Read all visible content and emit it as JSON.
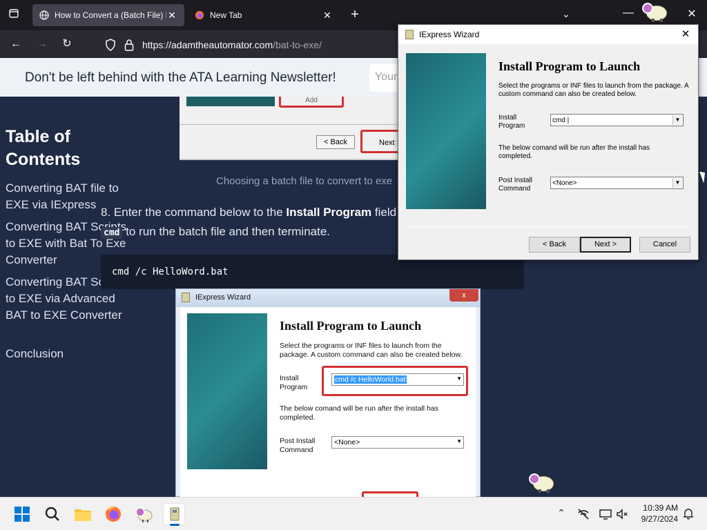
{
  "browser": {
    "tabs": [
      {
        "title": "How to Convert a (Batch File) BAT to EXE",
        "active": true
      },
      {
        "title": "New Tab",
        "active": false
      }
    ],
    "url_host": "https://adamtheautomator.com",
    "url_path": "/bat-to-exe/"
  },
  "page": {
    "newsletter_text": "Don't be left behind with the ATA Learning Newsletter!",
    "email_placeholder": "Your",
    "toc_title": "Table of Contents",
    "toc_items": [
      "Converting BAT file to EXE via IExpress",
      "Converting BAT Scripts to EXE with Bat To Exe Converter",
      "Converting BAT Scripts to EXE via Advanced BAT to EXE Converter",
      "Conclusion"
    ],
    "top_shot": {
      "add_label": "Add",
      "back_label": "< Back",
      "next_label": "Next >"
    },
    "caption": "Choosing a batch file to convert to exe",
    "step_prefix": "8. Enter the command below to the ",
    "step_bold": "Install Program",
    "step_suffix": " field",
    "step_code": "cmd",
    "step_line2": " to run the batch file and then terminate.",
    "code_block": "cmd /c HelloWord.bat"
  },
  "embedded_wizard": {
    "title": "IExpress Wizard",
    "close": "x",
    "heading": "Install Program to Launch",
    "description": "Select the programs or INF files to launch from the package.  A custom command can also be created below.",
    "install_label": "Install Program",
    "install_value": "cmd /c HelloWorld.bat",
    "below_text": "The below comand will be run after the install has completed.",
    "post_label": "Post Install Command",
    "post_value": "<None>"
  },
  "dialog": {
    "title": "IExpress Wizard",
    "heading": "Install Program to Launch",
    "description": "Select the programs or INF files to launch from the package.  A custom command can also be created below.",
    "install_label": "Install Program",
    "install_value": "cmd |",
    "below_text": "The below comand will be run after the install has completed.",
    "post_label": "Post Install Command",
    "post_value": "<None>",
    "back_label": "< Back",
    "next_label": "Next >",
    "cancel_label": "Cancel"
  },
  "taskbar": {
    "time": "10:39 AM",
    "date": "9/27/2024"
  },
  "colors": {
    "page_bg": "#1f2a44",
    "highlight_red": "#d32f2f",
    "wizard_teal": "#1f6f78",
    "taskbar_accent": "#0067c0"
  }
}
